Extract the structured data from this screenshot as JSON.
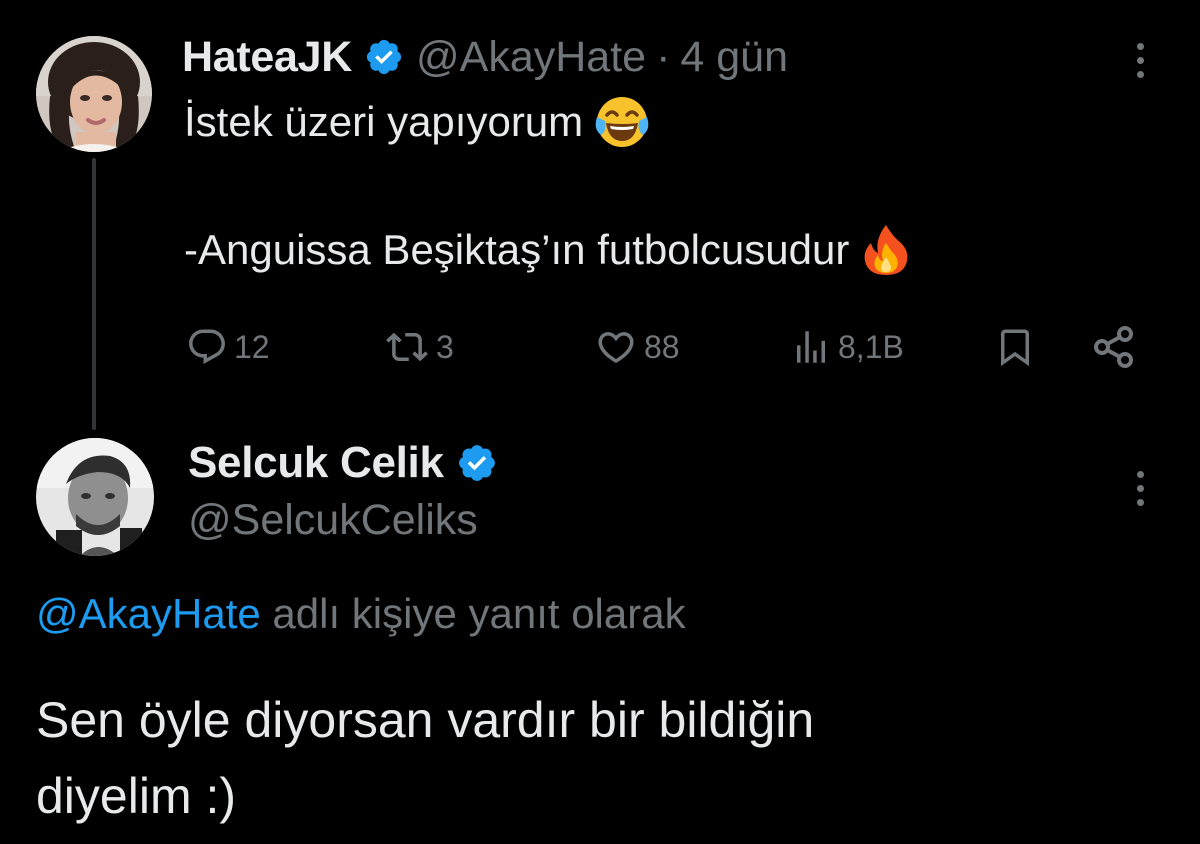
{
  "tweet1": {
    "display_name": "HateaJK",
    "handle": "@AkayHate",
    "separator": "·",
    "time": "4 gün",
    "text_line1": "İstek üzeri yapıyorum",
    "text_line2": "-Anguissa Beşiktaş’ın futbolcusudur",
    "emoji_line1": "face-with-tears-of-joy-icon",
    "emoji_line2": "fire-icon",
    "actions": {
      "replies": "12",
      "retweets": "3",
      "likes": "88",
      "views": "8,1B"
    }
  },
  "tweet2": {
    "display_name": "Selcuk Celik",
    "handle": "@SelcukCeliks",
    "reply_mention": "@AkayHate",
    "reply_suffix": " adlı kişiye yanıt olarak",
    "text_line1": "Sen öyle diyorsan vardır bir bildiğin",
    "text_line2": "diyelim :)"
  },
  "colors": {
    "background": "#000000",
    "text_primary": "#e7e9ea",
    "text_secondary": "#71767b",
    "accent_blue": "#1d9bf0",
    "thread_line": "#333639"
  }
}
